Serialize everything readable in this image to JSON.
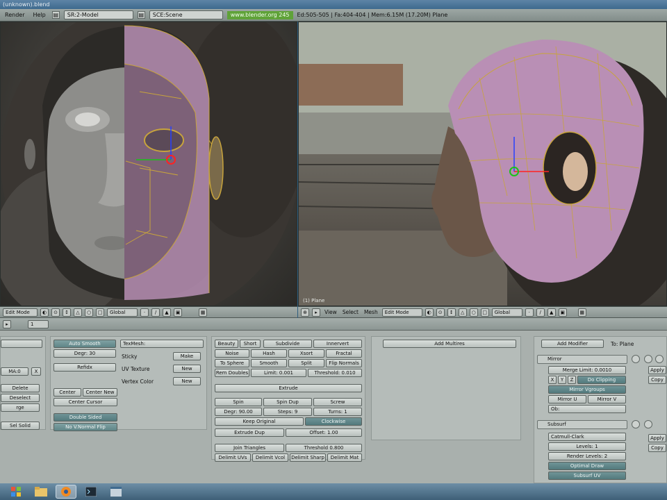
{
  "window": {
    "title": "(unknown).blend"
  },
  "info_header": {
    "menus": [
      "Render",
      "Help"
    ],
    "screen": "SR:2-Model",
    "scene": "SCE:Scene",
    "website": "www.blender.org 245",
    "stats": "Ed:505-505 | Fa:404-404 | Mem:6.15M (17.20M) Plane"
  },
  "left_viewport": {
    "mode": "Edit Mode",
    "orientation": "Global"
  },
  "right_viewport": {
    "label": "(1) Plane",
    "menus": [
      "View",
      "Select",
      "Mesh"
    ],
    "mode": "Edit Mode",
    "orientation": "Global"
  },
  "buttons_header": {
    "frame": "1"
  },
  "link_panel": {
    "mat_field": "MA:0",
    "x_button": "X",
    "delete": "Delete",
    "deselect": "Deselect",
    "merge": "rge",
    "sel_solid": "Sel Solid"
  },
  "mesh_panel": {
    "auto_smooth": "Auto Smooth",
    "degr": "Degr: 30",
    "refidx": "Refidx",
    "center": "Center",
    "center_new": "Center New",
    "center_cursor": "Center Cursor",
    "double_sided": "Double Sided",
    "no_vnormal_flip": "No V.Normal Flip",
    "texmesh": "TexMesh:",
    "sticky": "Sticky",
    "uv_texture": "UV Texture",
    "vertex_color": "Vertex Color",
    "make": "Make",
    "new1": "New",
    "new2": "New"
  },
  "mesh_tools": {
    "beauty": "Beauty",
    "short": "Short",
    "subdivide": "Subdivide",
    "innervert": "Innervert",
    "noise": "Noise",
    "hash": "Hash",
    "xsort": "Xsort",
    "fractal": "Fractal",
    "to_sphere": "To Sphere",
    "smooth": "Smooth",
    "split": "Split",
    "flip_normals": "Flip Normals",
    "rem_doubles": "Rem Doubles",
    "limit": "Limit: 0.001",
    "threshold": "Threshold: 0.010",
    "extrude": "Extrude",
    "spin": "Spin",
    "spin_dup": "Spin Dup",
    "screw": "Screw",
    "degr_spin": "Degr: 90.00",
    "steps": "Steps: 9",
    "turns": "Turns: 1",
    "keep_original": "Keep Original",
    "clockwise": "Clockwise",
    "extrude_dup": "Extrude Dup",
    "offset": "Offset: 1.00",
    "join_triangles": "Join Triangles",
    "threshold2": "Threshold 0.800",
    "delimit_uvs": "Delimit UVs",
    "delimit_vcol": "Delimit Vcol",
    "delimit_sharp": "Delimit Sharp",
    "delimit_mat": "Delimit Mat"
  },
  "multires_panel": {
    "add_multires": "Add Multires"
  },
  "modifiers_panel": {
    "add_modifier": "Add Modifier",
    "to": "To: Plane",
    "mirror": {
      "name": "Mirror",
      "merge_limit": "Merge Limit: 0.0010",
      "x": "X",
      "y": "Y",
      "z": "Z",
      "do_clipping": "Do Clipping",
      "mirror_vgroups": "Mirror Vgroups",
      "mirror_u": "Mirror U",
      "mirror_v": "Mirror V",
      "ob": "Ob:"
    },
    "subsurf": {
      "name": "Subsurf",
      "type": "Catmull-Clark",
      "levels": "Levels: 1",
      "render_levels": "Render Levels: 2",
      "optimal_draw": "Optimal Draw",
      "subsurf_uv": "Subsurf UV"
    },
    "apply1": "Apply",
    "copy1": "Copy",
    "apply2": "Apply",
    "copy2": "Copy"
  },
  "colors": {
    "accent": "#5f8587",
    "website": "#5fa238",
    "mesh_wire": "#c8a43c",
    "mesh_face": "#b98fb5"
  }
}
